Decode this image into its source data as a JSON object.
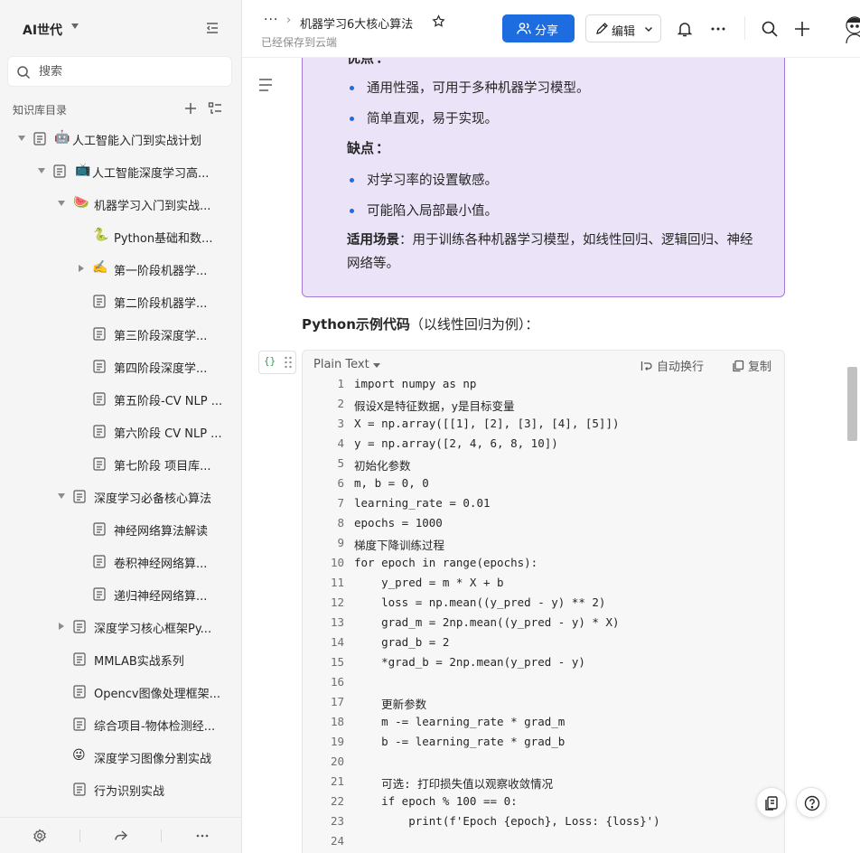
{
  "sidebar": {
    "space_name": "AI世代",
    "search_placeholder": "搜索",
    "tree_header": "知识库目录",
    "items": [
      {
        "label": "人工智能入门到实战计划",
        "emoji": "🤖"
      },
      {
        "label": "人工智能深度学习高...",
        "emoji": "📺"
      },
      {
        "label": "机器学习入门到实战...",
        "emoji": "🍉"
      },
      {
        "label": "Python基础和数...",
        "emoji": "🐍"
      },
      {
        "label": "第一阶段机器学...",
        "emoji": "✍️"
      },
      {
        "label": "第二阶段机器学..."
      },
      {
        "label": "第三阶段深度学..."
      },
      {
        "label": "第四阶段深度学..."
      },
      {
        "label": "第五阶段-CV NLP ..."
      },
      {
        "label": "第六阶段 CV NLP ..."
      },
      {
        "label": "第七阶段 项目库..."
      },
      {
        "label": "深度学习必备核心算法"
      },
      {
        "label": "神经网络算法解读"
      },
      {
        "label": "卷积神经网络算..."
      },
      {
        "label": "递归神经网络算..."
      },
      {
        "label": "深度学习核心框架Py..."
      },
      {
        "label": "MMLAB实战系列"
      },
      {
        "label": "Opencv图像处理框架..."
      },
      {
        "label": "综合项目-物体检测经..."
      },
      {
        "label": "深度学习图像分割实战",
        "emoji": "😜"
      },
      {
        "label": "行为识别实战"
      }
    ]
  },
  "topbar": {
    "more": "···",
    "title": "机器学习6大核心算法",
    "save_status": "已经保存到云端",
    "share": "分享",
    "edit": "编辑"
  },
  "callout": {
    "pros_title": "优点",
    "pros": [
      "通用性强，可用于多种机器学习模型。",
      "简单直观，易于实现。"
    ],
    "cons_title": "缺点",
    "cons": [
      "对学习率的设置敏感。",
      "可能陷入局部最小值。"
    ],
    "scene_title": "适用场景",
    "scene_text": "用于训练各种机器学习模型，如线性回归、逻辑回归、神经网络等。"
  },
  "section": {
    "heading_bold": "Python示例代码",
    "heading_rest": "（以线性回归为例）："
  },
  "code": {
    "language": "Plain Text",
    "wrap_label": "自动换行",
    "copy_label": "复制",
    "lines": [
      "import numpy as np",
      "假设X是特征数据，y是目标变量",
      "X = np.array([[1], [2], [3], [4], [5]])",
      "y = np.array([2, 4, 6, 8, 10])",
      "初始化参数",
      "m, b = 0, 0",
      "learning_rate = 0.01",
      "epochs = 1000",
      "梯度下降训练过程",
      "for epoch in range(epochs):",
      "    y_pred = m * X + b",
      "    loss = np.mean((y_pred - y) ** 2)",
      "    grad_m = 2np.mean((y_pred - y) * X)",
      "    grad_b = 2",
      "    *grad_b = 2np.mean(y_pred - y)",
      "",
      "    更新参数",
      "    m -= learning_rate * grad_m",
      "    b -= learning_rate * grad_b",
      "",
      "    可选: 打印损失值以观察收敛情况",
      "    if epoch % 100 == 0:",
      "        print(f'Epoch {epoch}, Loss: {loss}')",
      ""
    ]
  }
}
